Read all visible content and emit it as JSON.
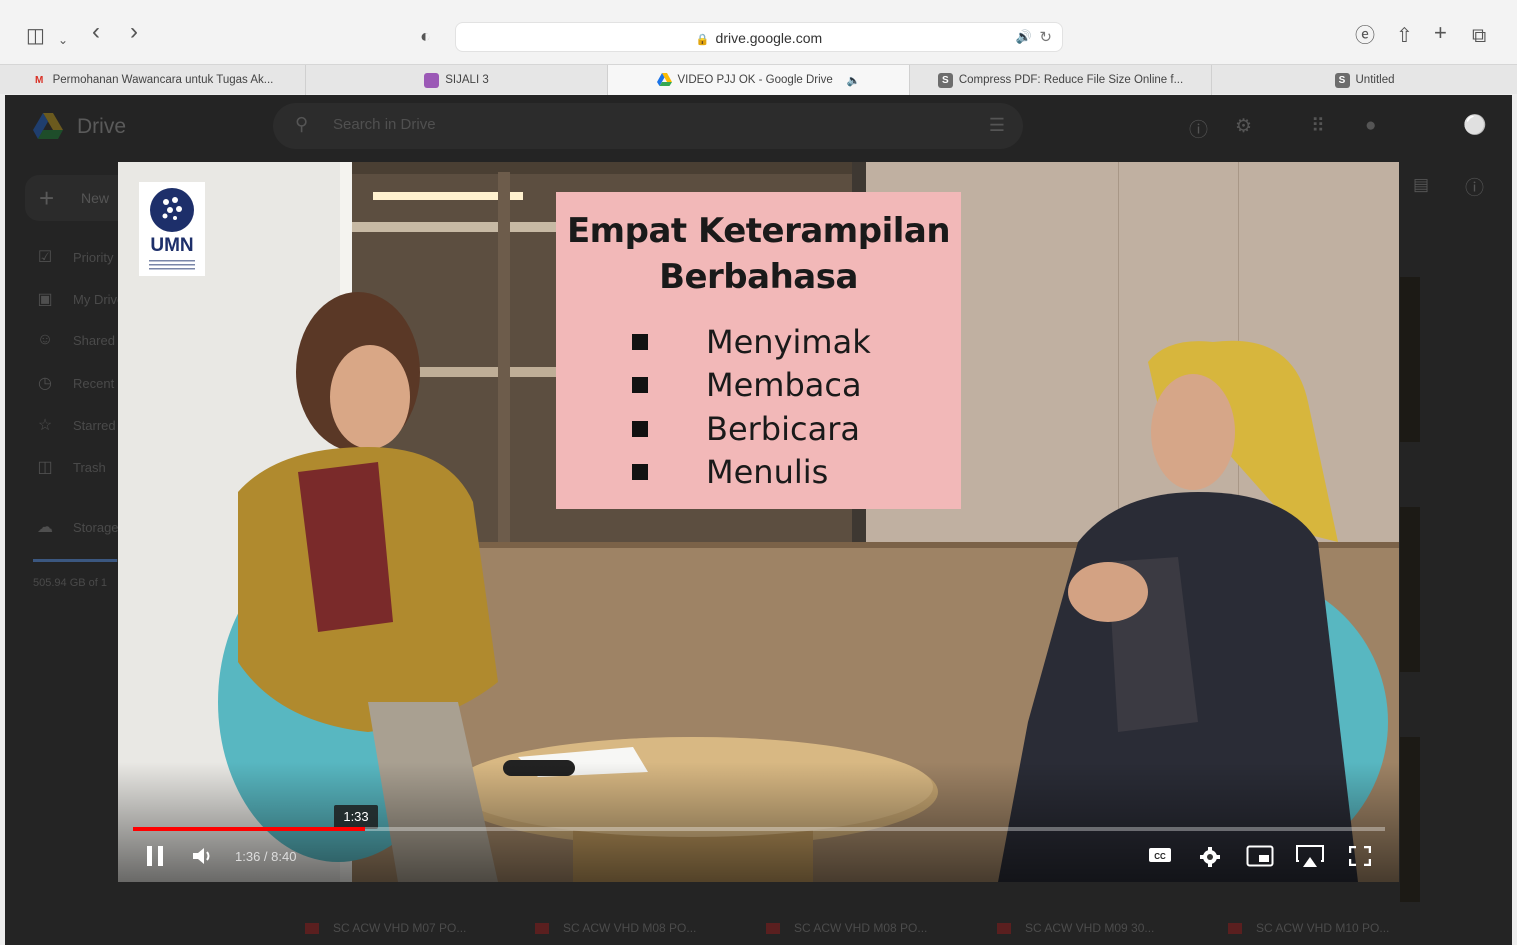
{
  "browser": {
    "url": "drive.google.com",
    "tabs": [
      {
        "label": "Permohanan Wawancara untuk Tugas Ak...",
        "favicon": "gmail-icon",
        "color": "#d93025"
      },
      {
        "label": "SIJALI 3",
        "favicon": "app-icon",
        "color": "#8e44ad"
      },
      {
        "label": "VIDEO PJJ OK - Google Drive",
        "favicon": "google-drive-icon",
        "color": "#1a73e8"
      },
      {
        "label": "Compress PDF: Reduce File Size Online f...",
        "favicon": "s-icon",
        "color": "#6d6d6d"
      },
      {
        "label": "Untitled",
        "favicon": "s-icon",
        "color": "#6d6d6d"
      }
    ]
  },
  "drive": {
    "title": "Drive",
    "search_placeholder": "Search in Drive",
    "new_label": "New",
    "sidebar": [
      "Priority",
      "My Drive",
      "Shared",
      "Recent",
      "Starred",
      "Trash",
      "Storage"
    ],
    "storage_text": "505.94 GB of 1",
    "files": [
      "SC ACW VHD M07 PO...",
      "SC ACW VHD M08 PO...",
      "SC ACW VHD M08 PO...",
      "SC ACW VHD M09 30...",
      "SC ACW VHD M10 PO..."
    ]
  },
  "video": {
    "logo_text": "UMN",
    "slide_title_line1": "Empat Keterampilan",
    "slide_title_line2": "Berbahasa",
    "skills": [
      "Menyimak",
      "Membaca",
      "Berbicara",
      "Menulis"
    ],
    "current_time": "1:36",
    "duration": "8:40",
    "time_display": "1:36 / 8:40",
    "hover_time": "1:33",
    "progress_fraction": 0.185,
    "accent_color": "#ff0000"
  }
}
